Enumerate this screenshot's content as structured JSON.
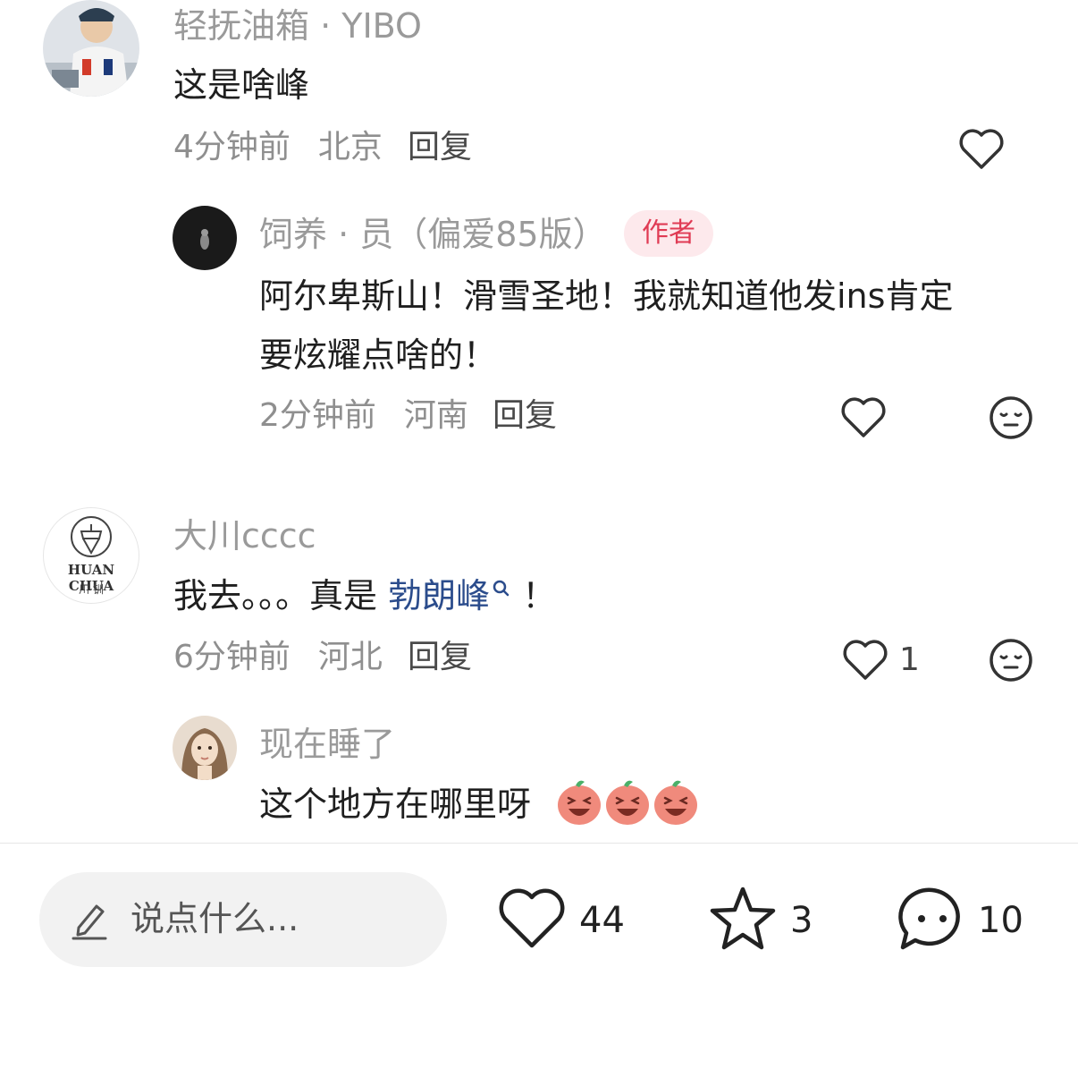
{
  "comments": [
    {
      "username": "轻抚油箱 · YIBO",
      "text": "这是啥峰",
      "time": "4分钟前",
      "location": "北京",
      "reply_label": "回复",
      "avatar_icon": "user-photo-racing",
      "replies": [
        {
          "username": "饲养 · 员（偏爱85版）",
          "badge": "作者",
          "text_lines": [
            "阿尔卑斯山！滑雪圣地！我就知道他发ins肯定",
            "要炫耀点啥的！"
          ],
          "time": "2分钟前",
          "location": "河南",
          "reply_label": "回复",
          "avatar_icon": "user-photo-dark"
        }
      ]
    },
    {
      "username": "大川cccc",
      "avatar_text_top": "HUAN CHUA",
      "avatar_text_bottom": "川·钏",
      "text_prefix": "我去。。。真是 ",
      "text_link": "勃朗峰",
      "text_suffix": " ！",
      "time": "6分钟前",
      "location": "河北",
      "reply_label": "回复",
      "like_count": "1",
      "replies": [
        {
          "username": "现在睡了",
          "text": "这个地方在哪里呀",
          "avatar_icon": "user-photo-girl"
        }
      ]
    }
  ],
  "bottom_bar": {
    "input_placeholder": "说点什么...",
    "likes": "44",
    "stars": "3",
    "comments": "10"
  },
  "colors": {
    "badge_bg": "#fde9ec",
    "badge_text": "#e03b54",
    "link": "#2b4c8c",
    "muted": "#9a9a9a"
  }
}
